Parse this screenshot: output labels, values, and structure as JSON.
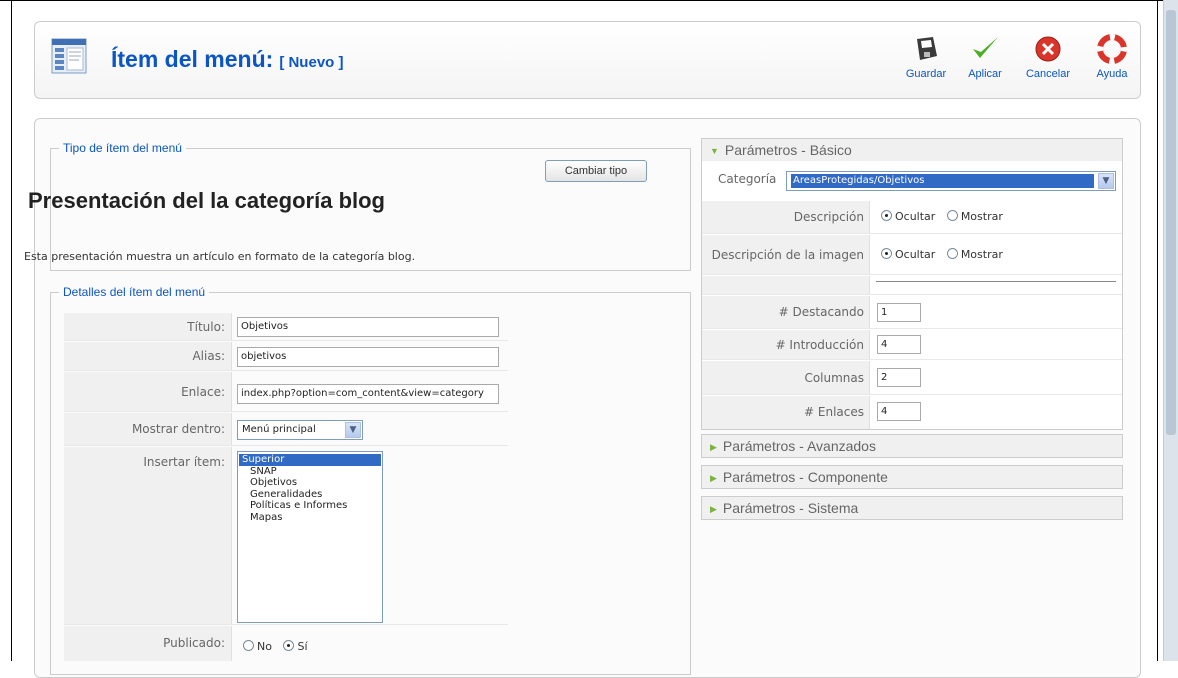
{
  "header": {
    "title": "Ítem del menú:",
    "status": "[ Nuevo ]"
  },
  "toolbar": {
    "save_label": "Guardar",
    "apply_label": "Aplicar",
    "cancel_label": "Cancelar",
    "help_label": "Ayuda"
  },
  "menu_type": {
    "legend": "Tipo de ítem del menú",
    "change_button": "Cambiar tipo",
    "layout_title": "Presentación del la categoría blog",
    "layout_description": "Esta presentación muestra un artículo en formato de la categoría blog."
  },
  "details": {
    "legend": "Detalles del ítem del menú",
    "title_label": "Título:",
    "title_value": "Objetivos",
    "alias_label": "Alias:",
    "alias_value": "objetivos",
    "link_label": "Enlace:",
    "link_value": "index.php?option=com_content&view=category",
    "display_in_label": "Mostrar dentro:",
    "display_in_value": "Menú principal",
    "parent_label": "Insertar ítem:",
    "parent_options": [
      "Superior",
      "SNAP",
      "Objetivos",
      "Generalidades",
      "Políticas e Informes",
      "Mapas"
    ],
    "parent_selected": "Superior",
    "published_label": "Publicado:",
    "published_no": "No",
    "published_yes": "Sí",
    "published_value": "Sí"
  },
  "params_basic": {
    "header": "Parámetros - Básico",
    "category_label": "Categoría",
    "category_value": "AreasProtegidas/Objetivos",
    "description_label": "Descripción",
    "desc_image_label": "Descripción de la imagen",
    "hide_label": "Ocultar",
    "show_label": "Mostrar",
    "description_value": "Ocultar",
    "desc_image_value": "Ocultar",
    "leading_label": "# Destacando",
    "leading_value": "1",
    "intro_label": "# Introducción",
    "intro_value": "4",
    "columns_label": "Columnas",
    "columns_value": "2",
    "links_label": "# Enlaces",
    "links_value": "4"
  },
  "params_other": {
    "advanced": "Parámetros - Avanzados",
    "component": "Parámetros - Componente",
    "system": "Parámetros - Sistema"
  },
  "colors": {
    "accent": "#0b55c4",
    "selected": "#316ac5",
    "panel_bg": "#f0f0f0"
  },
  "icons": [
    "menu-item-icon",
    "save-icon",
    "apply-check-icon",
    "cancel-icon",
    "help-lifebuoy-icon"
  ]
}
